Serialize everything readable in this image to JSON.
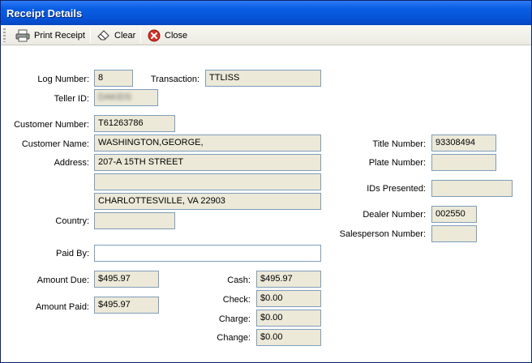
{
  "window": {
    "title": "Receipt Details"
  },
  "toolbar": {
    "print_label": "Print Receipt",
    "clear_label": "Clear",
    "close_label": "Close"
  },
  "form": {
    "log_number_label": "Log Number:",
    "log_number": "8",
    "transaction_label": "Transaction:",
    "transaction": "TTLISS",
    "teller_id_label": "Teller ID:",
    "teller_id": "DAKIDS",
    "customer_number_label": "Customer Number:",
    "customer_number": "T61263786",
    "customer_name_label": "Customer Name:",
    "customer_name": "WASHINGTON,GEORGE,",
    "address_label": "Address:",
    "address_line1": "207-A 15TH STREET",
    "address_line2": "",
    "address_line3": "CHARLOTTESVILLE, VA 22903",
    "country_label": "Country:",
    "country": "",
    "paid_by_label": "Paid By:",
    "paid_by": "",
    "amount_due_label": "Amount Due:",
    "amount_due": "$495.97",
    "amount_paid_label": "Amount Paid:",
    "amount_paid": "$495.97",
    "cash_label": "Cash:",
    "cash": "$495.97",
    "check_label": "Check:",
    "check": "$0.00",
    "charge_label": "Charge:",
    "charge": "$0.00",
    "change_label": "Change:",
    "change": "$0.00",
    "title_number_label": "Title Number:",
    "title_number": "93308494",
    "plate_number_label": "Plate Number:",
    "plate_number": "",
    "ids_presented_label": "IDs Presented:",
    "ids_presented": "",
    "dealer_number_label": "Dealer Number:",
    "dealer_number": "002550",
    "salesperson_number_label": "Salesperson Number:",
    "salesperson_number": ""
  },
  "icons": {
    "print": "printer-icon",
    "clear": "eraser-icon",
    "close": "close-circle-icon"
  },
  "colors": {
    "titlebar": "#0654d8",
    "field_bg": "#ece9d8",
    "field_border": "#7f9db9",
    "close_red": "#d6322a"
  }
}
